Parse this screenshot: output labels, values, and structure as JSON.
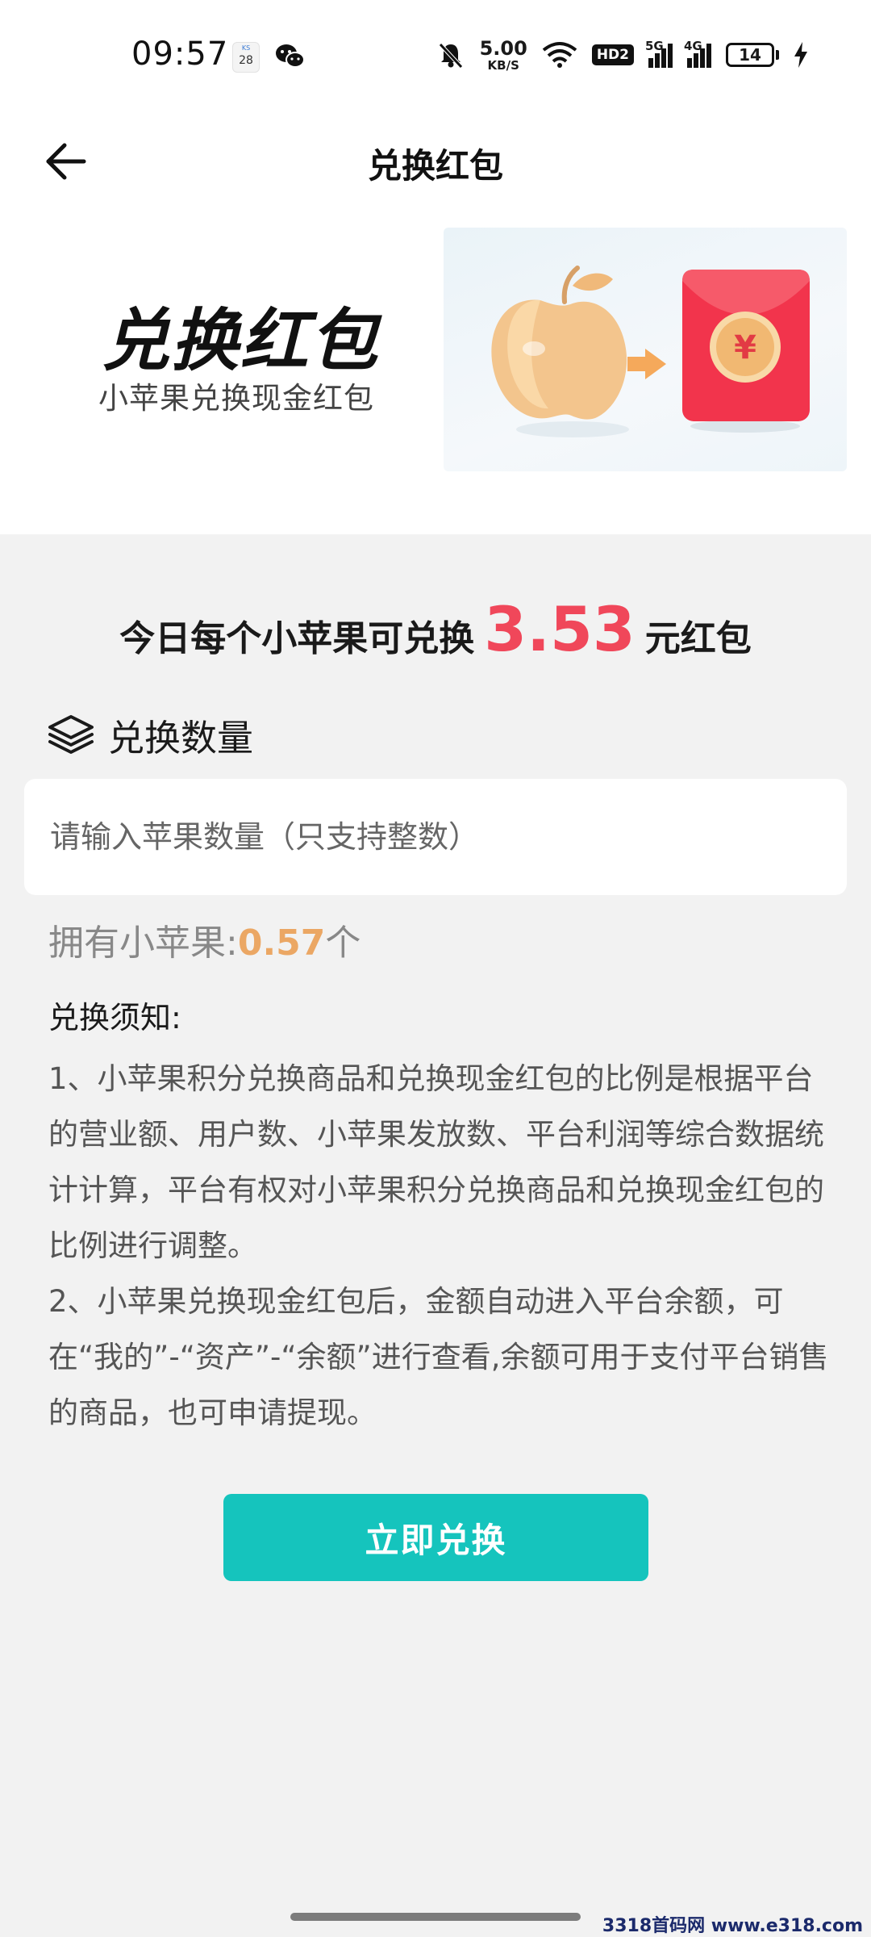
{
  "status_bar": {
    "time": "09:57",
    "calendar_badge": "28",
    "calendar_top": "KS",
    "net_speed_value": "5.00",
    "net_speed_unit": "KB/S",
    "hd_label": "HD2",
    "signal_1_tag": "5G",
    "signal_2_tag": "4G",
    "battery": "14",
    "icons": [
      "wechat-icon",
      "mute-icon",
      "wifi-icon",
      "charging-icon"
    ]
  },
  "nav": {
    "title": "兑换红包",
    "back_icon": "arrow-left-icon"
  },
  "banner": {
    "title": "兑换红包",
    "subtitle": "小苹果兑换现金红包",
    "red_packet_symbol": "¥",
    "icons": [
      "apple-icon",
      "arrow-right-icon",
      "red-packet-icon"
    ]
  },
  "rate": {
    "prefix": "今日每个小苹果可兑换",
    "value": "3.53",
    "suffix": "元红包",
    "value_color": "#f0475a"
  },
  "quantity": {
    "section_title": "兑换数量",
    "section_icon": "layers-icon",
    "input_placeholder": "请输入苹果数量（只支持整数）",
    "input_value": ""
  },
  "owned": {
    "label": "拥有小苹果:",
    "value": "0.57",
    "unit": "个",
    "value_color": "#eba764"
  },
  "notice": {
    "title": "兑换须知:",
    "items": [
      "1、小苹果积分兑换商品和兑换现金红包的比例是根据平台的营业额、用户数、小苹果发放数、平台利润等综合数据统计计算，平台有权对小苹果积分兑换商品和兑换现金红包的比例进行调整。",
      "2、小苹果兑换现金红包后，金额自动进入平台余额，可在“我的”-“资产”-“余额”进行查看,余额可用于支付平台销售的商品，也可申请提现。"
    ]
  },
  "action": {
    "exchange_label": "立即兑换",
    "button_color": "#15c4bd"
  },
  "watermark": "3318首码网 www.e318.com"
}
